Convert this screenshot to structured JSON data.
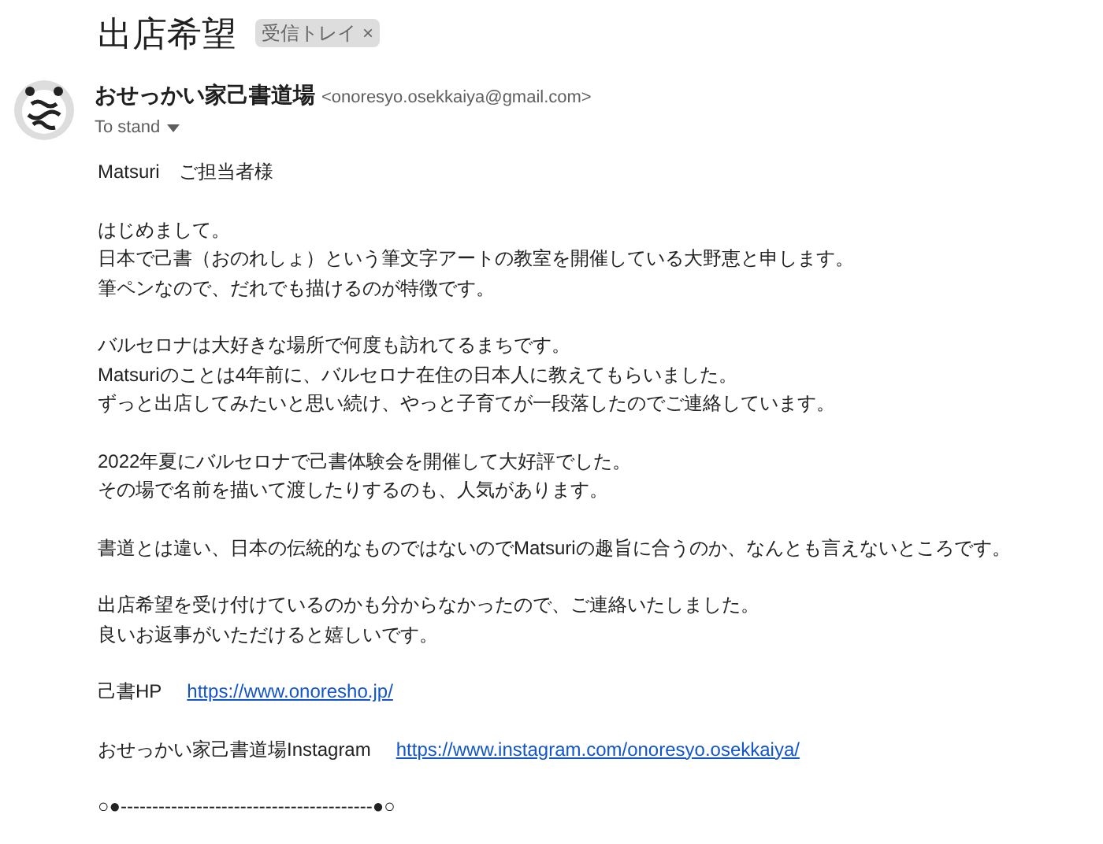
{
  "subject": "出店希望",
  "label": {
    "text": "受信トレイ",
    "close": "×"
  },
  "sender": {
    "name": "おせっかい家己書道場",
    "email": "<onoresyo.osekkaiya@gmail.com>",
    "to": "To stand"
  },
  "body": [
    {
      "kind": "text",
      "lines": [
        "Matsuri　ご担当者様"
      ]
    },
    {
      "kind": "text",
      "lines": [
        "はじめまして。",
        "日本で己書（おのれしょ）という筆文字アートの教室を開催している大野恵と申します。",
        "筆ペンなので、だれでも描けるのが特徴です。"
      ]
    },
    {
      "kind": "text",
      "lines": [
        "バルセロナは大好きな場所で何度も訪れてるまちです。",
        "Matsuriのことは4年前に、バルセロナ在住の日本人に教えてもらいました。",
        "ずっと出店してみたいと思い続け、やっと子育てが一段落したのでご連絡しています。"
      ]
    },
    {
      "kind": "text",
      "lines": [
        "2022年夏にバルセロナで己書体験会を開催して大好評でした。",
        "その場で名前を描いて渡したりするのも、人気があります。"
      ]
    },
    {
      "kind": "text",
      "lines": [
        "書道とは違い、日本の伝統的なものではないのでMatsuriの趣旨に合うのか、なんとも言えないところです。"
      ]
    },
    {
      "kind": "text",
      "lines": [
        "出店希望を受け付けているのかも分からなかったので、ご連絡いたしました。",
        "良いお返事がいただけると嬉しいです。"
      ]
    },
    {
      "kind": "link",
      "label": "己書HP",
      "url": "https://www.onoresho.jp/"
    },
    {
      "kind": "link",
      "label": "おせっかい家己書道場Instagram",
      "url": "https://www.instagram.com/onoresyo.osekkaiya/"
    },
    {
      "kind": "text",
      "lines": [
        "○●----------------------------------------●○"
      ]
    }
  ]
}
